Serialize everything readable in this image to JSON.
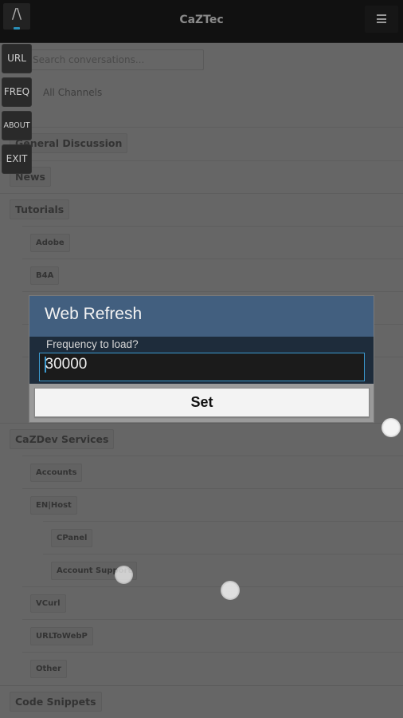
{
  "header": {
    "title": "CaZTec",
    "logo_glyph": "/\\",
    "logo_icon": "caret-up-logo-icon",
    "menu_icon": "hamburger-menu-icon"
  },
  "search": {
    "placeholder": "Search conversations..."
  },
  "channels_label": "All Channels",
  "side_buttons": [
    {
      "label": "URL"
    },
    {
      "label": "FREQ"
    },
    {
      "label": "ABOUT"
    },
    {
      "label": "EXIT"
    }
  ],
  "channels": [
    {
      "label": "General Discussion",
      "level": 0
    },
    {
      "label": "News",
      "level": 0
    },
    {
      "label": "Tutorials",
      "level": 0
    },
    {
      "label": "Adobe",
      "level": 1
    },
    {
      "label": "B4A",
      "level": 1
    },
    {
      "label": "CaZDev Services",
      "level": 0
    },
    {
      "label": "Accounts",
      "level": 1
    },
    {
      "label": "EN|Host",
      "level": 1
    },
    {
      "label": "CPanel",
      "level": 2
    },
    {
      "label": "Account Support",
      "level": 2
    },
    {
      "label": "VCurl",
      "level": 1
    },
    {
      "label": "URLToWebP",
      "level": 1
    },
    {
      "label": "Other",
      "level": 1
    },
    {
      "label": "Code Snippets",
      "level": 0
    }
  ],
  "dialog": {
    "title": "Web Refresh",
    "prompt": "Frequency to load?",
    "input_value": "30000",
    "button_label": "Set",
    "accent_color": "#3b9ad0",
    "header_color": "#425f7f"
  }
}
